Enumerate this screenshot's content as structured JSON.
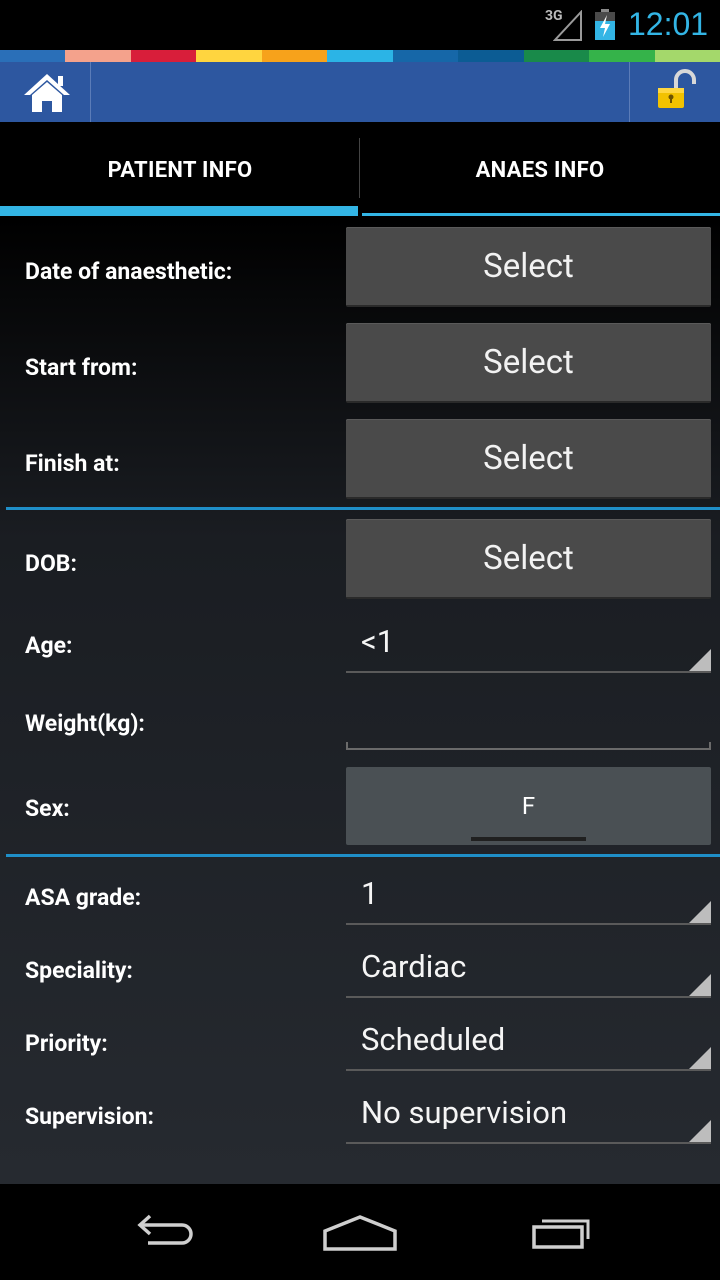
{
  "status_bar": {
    "network": "3G",
    "clock": "12:01",
    "signal_icon": "signal-icon",
    "battery_icon": "battery-charging-icon"
  },
  "stripe_colors": [
    "#2a6fb8",
    "#f4a28c",
    "#d81e3a",
    "#ffd53f",
    "#f7a21b",
    "#2bb4e6",
    "#1667a8",
    "#0c5c94",
    "#198a4a",
    "#35b34a",
    "#a4d86b"
  ],
  "action_bar": {
    "home_icon": "home-icon",
    "lock_icon": "unlock-icon",
    "accent": "#2d57a0"
  },
  "tabs": [
    {
      "label": "PATIENT INFO",
      "active": true
    },
    {
      "label": "ANAES INFO",
      "active": false
    }
  ],
  "form": {
    "date_of_anaesthetic": {
      "label": "Date of anaesthetic:",
      "button": "Select"
    },
    "start_from": {
      "label": "Start from:",
      "button": "Select"
    },
    "finish_at": {
      "label": "Finish at:",
      "button": "Select"
    },
    "dob": {
      "label": "DOB:",
      "button": "Select"
    },
    "age": {
      "label": "Age:",
      "value": "<1"
    },
    "weight": {
      "label": "Weight(kg):",
      "value": ""
    },
    "sex": {
      "label": "Sex:",
      "value": "F"
    },
    "asa_grade": {
      "label": "ASA grade:",
      "value": "1"
    },
    "speciality": {
      "label": "Speciality:",
      "value": "Cardiac"
    },
    "priority": {
      "label": "Priority:",
      "value": "Scheduled"
    },
    "supervision": {
      "label": "Supervision:",
      "value": "No supervision"
    }
  },
  "nav_bar": {
    "back_icon": "back-icon",
    "home_icon": "nav-home-icon",
    "recents_icon": "recent-apps-icon"
  }
}
